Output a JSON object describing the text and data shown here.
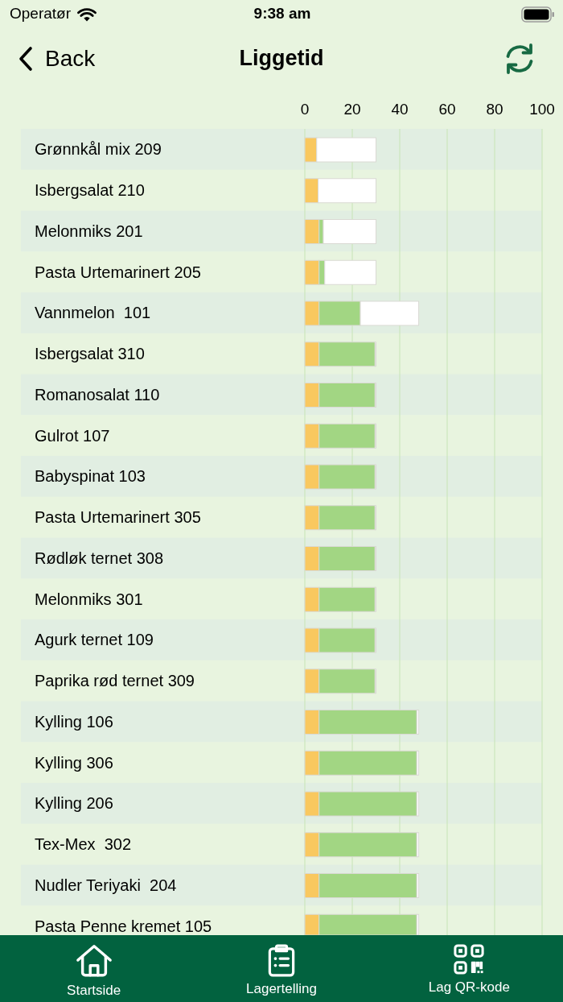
{
  "status_bar": {
    "carrier": "Operatør",
    "time": "9:38 am"
  },
  "header": {
    "back_label": "Back",
    "title": "Liggetid"
  },
  "chart": {
    "chart_data": {
      "type": "bar",
      "orientation": "horizontal",
      "stacked": true,
      "grid": true,
      "xlim": [
        0,
        100
      ],
      "xticks": [
        0,
        20,
        40,
        60,
        80,
        100
      ],
      "categories": [
        "Grønnkål mix 209",
        "Isbergsalat 210",
        "Melonmiks 201",
        "Pasta Urtemarinert 205",
        "Vannmelon  101",
        "Isbergsalat 310",
        "Romanosalat 110",
        "Gulrot 107",
        "Babyspinat 103",
        "Pasta Urtemarinert 305",
        "Rødløk ternet 308",
        "Melonmiks 301",
        "Agurk ternet 109",
        "Paprika rød ternet 309",
        "Kylling 106",
        "Kylling 306",
        "Kylling 206",
        "Tex-Mex  302",
        "Nudler Teriyaki  204",
        "Pasta Penne kremet 105"
      ],
      "series": [
        {
          "color": "#f9c85f",
          "values": [
            5,
            5.6,
            6,
            6,
            6,
            6,
            6,
            6,
            6,
            6,
            6,
            6,
            6,
            6,
            6,
            6,
            6,
            6,
            6,
            6
          ]
        },
        {
          "color": "#a2d683",
          "values": [
            0,
            0,
            1.8,
            2.4,
            17.4,
            23.6,
            23.6,
            23.6,
            23.6,
            23.6,
            23.6,
            23.6,
            23.6,
            23.6,
            41.2,
            41.2,
            41.2,
            41.2,
            41.2,
            41.2
          ]
        },
        {
          "color": "#ffffff",
          "values": [
            25,
            24.4,
            22.2,
            21.6,
            24.6,
            0.4,
            0.4,
            0.4,
            0.4,
            0.4,
            0.4,
            0.4,
            0.4,
            0.4,
            0.8,
            0.8,
            0.8,
            0.8,
            0.8,
            0.8
          ]
        }
      ]
    }
  },
  "tab_bar": [
    {
      "label": "Startside"
    },
    {
      "label": "Lagertelling"
    },
    {
      "label": "Lag QR-kode"
    }
  ]
}
